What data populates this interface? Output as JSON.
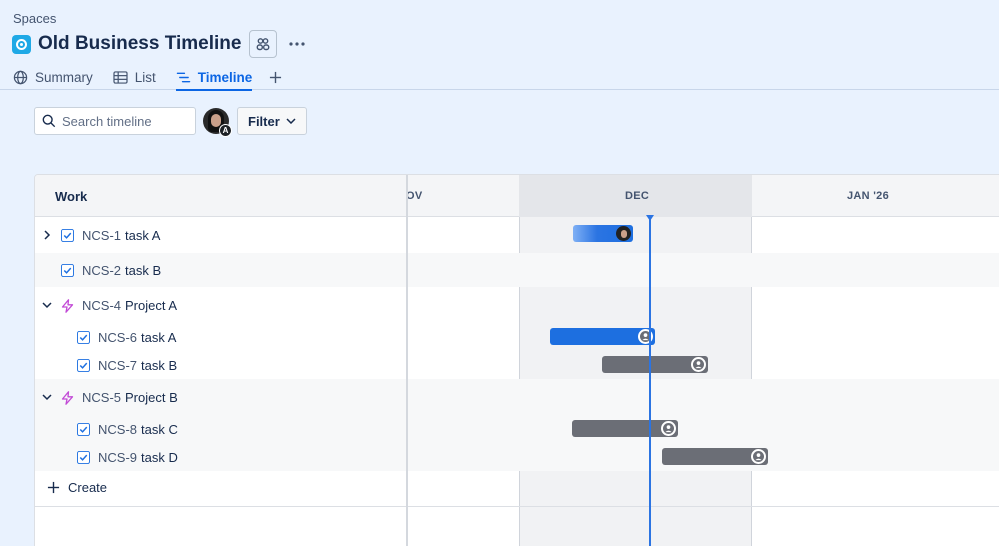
{
  "breadcrumb": "Spaces",
  "page_title": "Old Business Timeline",
  "tabs": [
    {
      "label": "Summary",
      "icon": "globe-icon"
    },
    {
      "label": "List",
      "icon": "list-icon"
    },
    {
      "label": "Timeline",
      "icon": "timeline-icon",
      "active": true
    }
  ],
  "search": {
    "placeholder": "Search timeline"
  },
  "avatar_badge": "A",
  "filter_label": "Filter",
  "grid": {
    "work_header": "Work",
    "months": [
      "OV",
      "DEC",
      "JAN '26"
    ],
    "create_label": "Create"
  },
  "rows": [
    {
      "key": "NCS-1",
      "name": "task A",
      "type": "task",
      "expandable": true,
      "expanded": false
    },
    {
      "key": "NCS-2",
      "name": "task B",
      "type": "task"
    },
    {
      "key": "NCS-4",
      "name": "Project A",
      "type": "epic",
      "expandable": true,
      "expanded": true
    },
    {
      "key": "NCS-6",
      "name": "task A",
      "type": "task",
      "child": true
    },
    {
      "key": "NCS-7",
      "name": "task B",
      "type": "task",
      "child": true
    },
    {
      "key": "NCS-5",
      "name": "Project B",
      "type": "epic",
      "expandable": true,
      "expanded": true
    },
    {
      "key": "NCS-8",
      "name": "task C",
      "type": "task",
      "child": true
    },
    {
      "key": "NCS-9",
      "name": "task D",
      "type": "task",
      "child": true
    }
  ],
  "colors": {
    "accent": "#0c66e4",
    "bar_blue": "#1d6fe0",
    "bar_grey": "#6b6e76",
    "epic": "#c24bd6",
    "today": "#2b74e2"
  }
}
